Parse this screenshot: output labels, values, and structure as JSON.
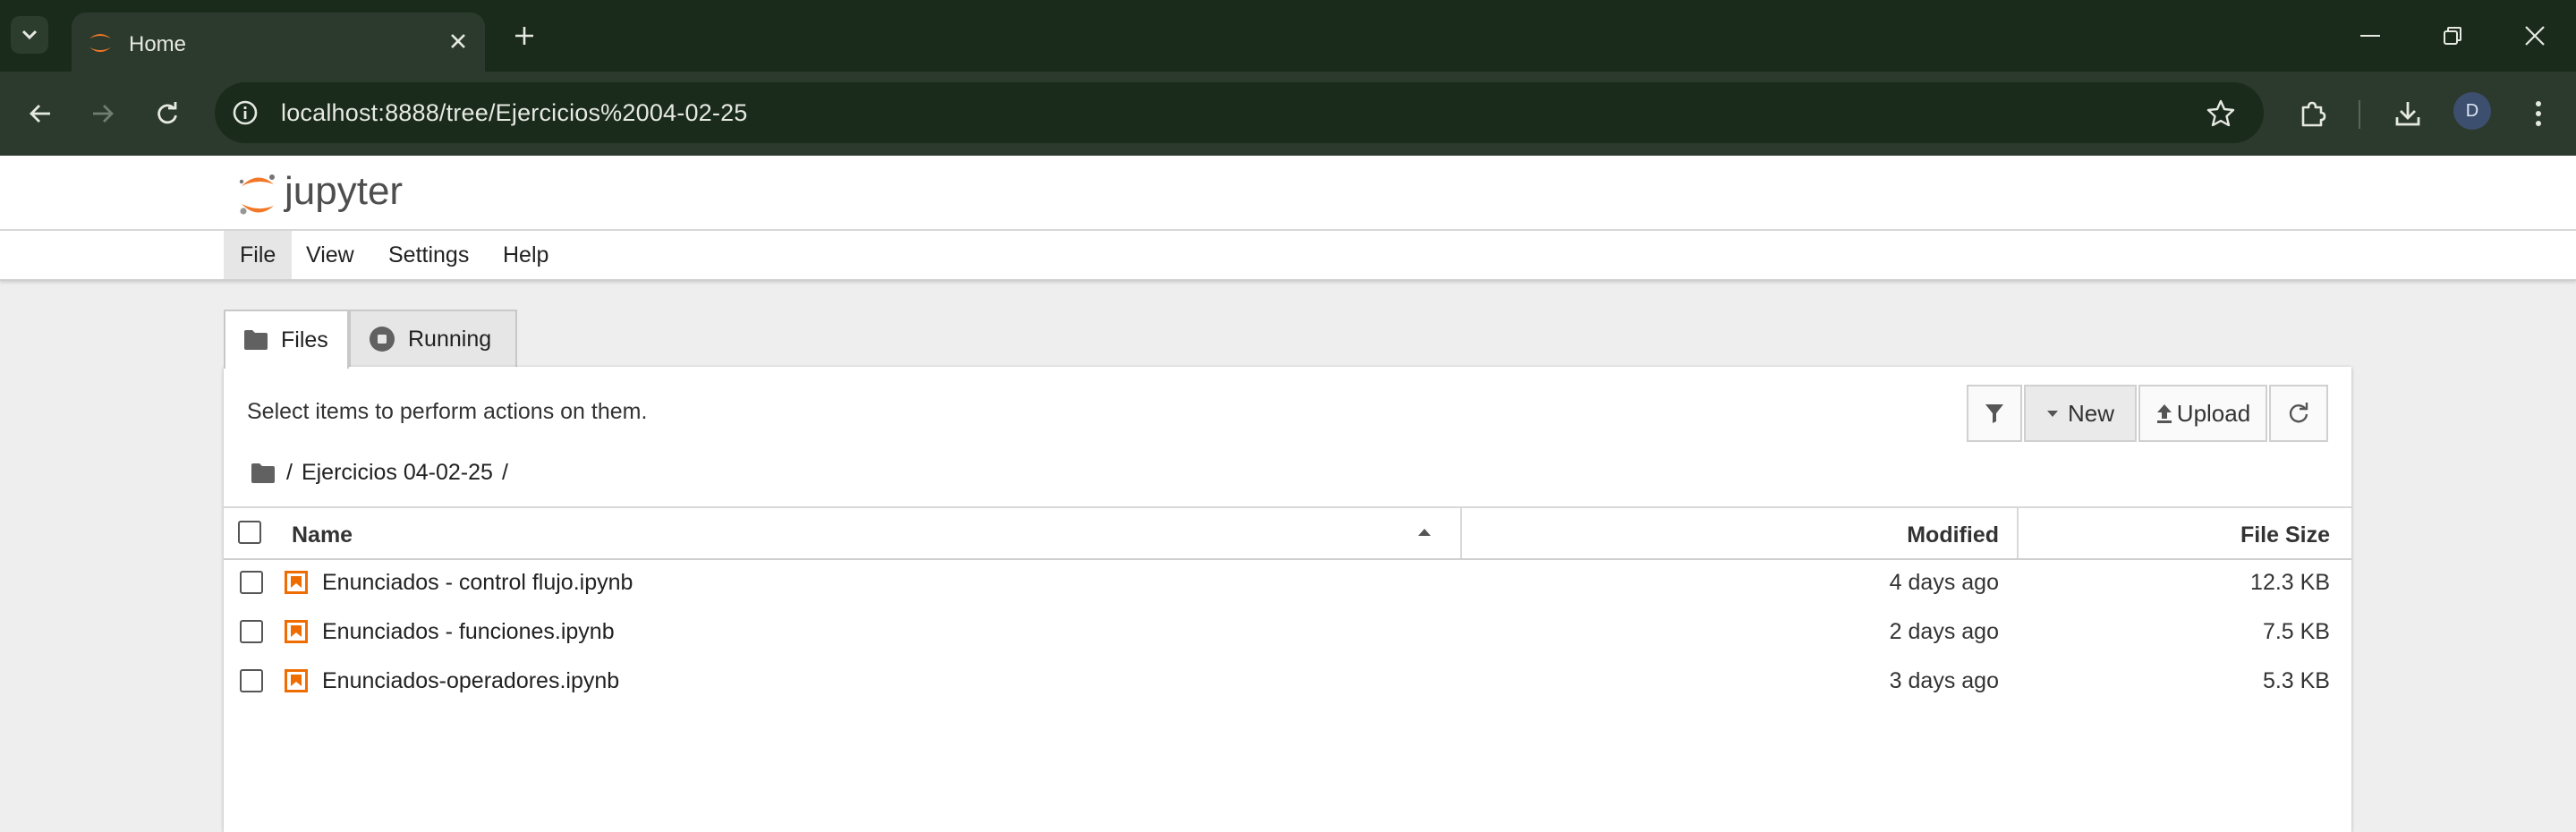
{
  "browser": {
    "tab_title": "Home",
    "url": "localhost:8888/tree/Ejercicios%2004-02-25",
    "profile_initial": "D"
  },
  "app": {
    "logo_text": "jupyter",
    "menu": [
      "File",
      "View",
      "Settings",
      "Help"
    ],
    "active_menu": "File"
  },
  "tabs": {
    "files": "Files",
    "running": "Running"
  },
  "panel": {
    "hint": "Select items to perform actions on them.",
    "filter_icon": "filter-icon",
    "new_label": "New",
    "upload_label": "Upload",
    "breadcrumb_sep": "/",
    "breadcrumb_folder": "Ejercicios 04-02-25",
    "columns": {
      "name": "Name",
      "modified": "Modified",
      "size": "File Size"
    },
    "files": [
      {
        "name": "Enunciados - control flujo.ipynb",
        "modified": "4 days ago",
        "size": "12.3 KB"
      },
      {
        "name": "Enunciados - funciones.ipynb",
        "modified": "2 days ago",
        "size": "7.5 KB"
      },
      {
        "name": "Enunciados-operadores.ipynb",
        "modified": "3 days ago",
        "size": "5.3 KB"
      }
    ]
  },
  "colors": {
    "chrome_dark": "#1a2a1b",
    "chrome_toolbar": "#2b3a2c",
    "jupyter_orange": "#f37726",
    "notebook_icon": "#ef6c00"
  }
}
